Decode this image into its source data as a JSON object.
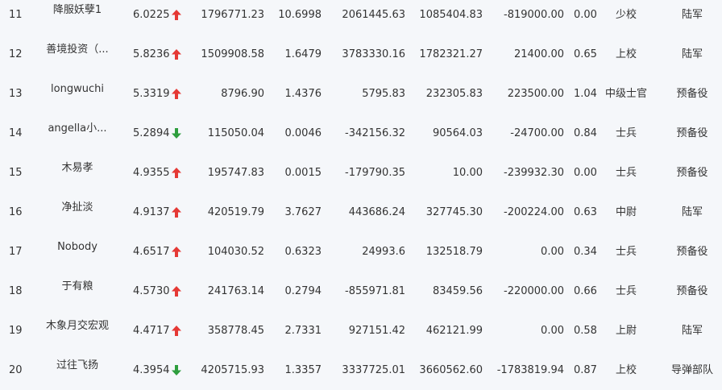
{
  "colors": {
    "up": "#e53935",
    "down": "#2e9e3e"
  },
  "rows": [
    {
      "rank": "11",
      "name": "降服妖孽1",
      "score": "6.0225",
      "trend": "up",
      "assets": "1796771.23",
      "ratio": "10.6998",
      "v1": "2061445.63",
      "v2": "1085404.83",
      "v3": "-819000.00",
      "frac": "0.00",
      "title": "少校",
      "army": "陆军"
    },
    {
      "rank": "12",
      "name": "善境投资（...",
      "score": "5.8236",
      "trend": "up",
      "assets": "1509908.58",
      "ratio": "1.6479",
      "v1": "3783330.16",
      "v2": "1782321.27",
      "v3": "21400.00",
      "frac": "0.65",
      "title": "上校",
      "army": "陆军"
    },
    {
      "rank": "13",
      "name": "longwuchi",
      "score": "5.3319",
      "trend": "up",
      "assets": "8796.90",
      "ratio": "1.4376",
      "v1": "5795.83",
      "v2": "232305.83",
      "v3": "223500.00",
      "frac": "1.04",
      "title": "中级士官",
      "army": "预备役"
    },
    {
      "rank": "14",
      "name": "angella小...",
      "score": "5.2894",
      "trend": "down",
      "assets": "115050.04",
      "ratio": "0.0046",
      "v1": "-342156.32",
      "v2": "90564.03",
      "v3": "-24700.00",
      "frac": "0.84",
      "title": "士兵",
      "army": "预备役"
    },
    {
      "rank": "15",
      "name": "木易孝",
      "score": "4.9355",
      "trend": "up",
      "assets": "195747.83",
      "ratio": "0.0015",
      "v1": "-179790.35",
      "v2": "10.00",
      "v3": "-239932.30",
      "frac": "0.00",
      "title": "士兵",
      "army": "预备役"
    },
    {
      "rank": "16",
      "name": "净扯淡",
      "score": "4.9137",
      "trend": "up",
      "assets": "420519.79",
      "ratio": "3.7627",
      "v1": "443686.24",
      "v2": "327745.30",
      "v3": "-200224.00",
      "frac": "0.63",
      "title": "中尉",
      "army": "陆军"
    },
    {
      "rank": "17",
      "name": "Nobody",
      "score": "4.6517",
      "trend": "up",
      "assets": "104030.52",
      "ratio": "0.6323",
      "v1": "24993.6",
      "v2": "132518.79",
      "v3": "0.00",
      "frac": "0.34",
      "title": "士兵",
      "army": "预备役"
    },
    {
      "rank": "18",
      "name": "于有粮",
      "score": "4.5730",
      "trend": "up",
      "assets": "241763.14",
      "ratio": "0.2794",
      "v1": "-855971.81",
      "v2": "83459.56",
      "v3": "-220000.00",
      "frac": "0.66",
      "title": "士兵",
      "army": "预备役"
    },
    {
      "rank": "19",
      "name": "木象月交宏观",
      "score": "4.4717",
      "trend": "up",
      "assets": "358778.45",
      "ratio": "2.7331",
      "v1": "927151.42",
      "v2": "462121.99",
      "v3": "0.00",
      "frac": "0.58",
      "title": "上尉",
      "army": "陆军"
    },
    {
      "rank": "20",
      "name": "过往飞扬",
      "score": "4.3954",
      "trend": "down",
      "assets": "4205715.93",
      "ratio": "1.3357",
      "v1": "3337725.01",
      "v2": "3660562.60",
      "v3": "-1783819.94",
      "frac": "0.87",
      "title": "上校",
      "army": "导弹部队"
    }
  ]
}
